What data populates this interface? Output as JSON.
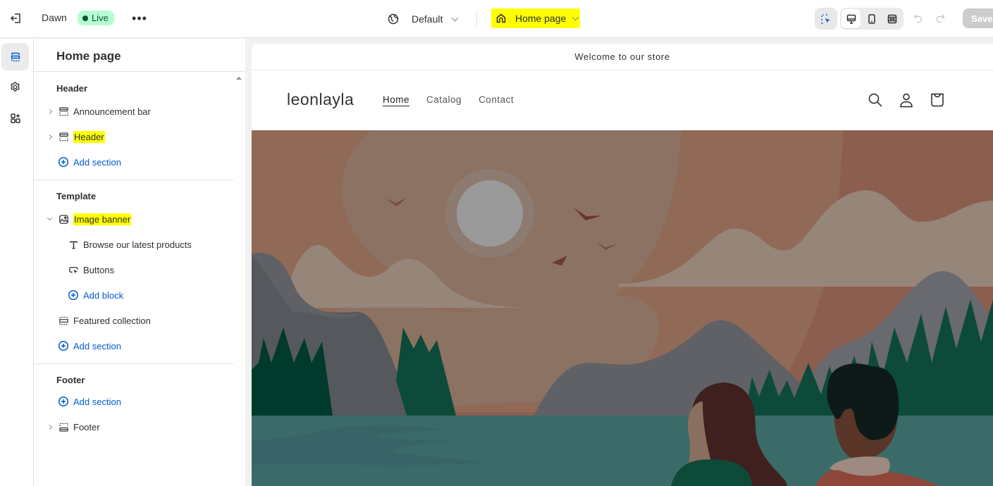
{
  "topbar": {
    "theme_name": "Dawn",
    "status_badge": "Live",
    "more_label": "•••",
    "market_label": "Default",
    "page_selector_label": "Home page",
    "save_label": "Save"
  },
  "rail": {
    "items": [
      {
        "name": "sections",
        "active": true
      },
      {
        "name": "theme-settings",
        "active": false
      },
      {
        "name": "apps",
        "active": false
      }
    ]
  },
  "panel": {
    "title": "Home page",
    "groups": {
      "header": {
        "title": "Header",
        "items": [
          "Announcement bar",
          "Header"
        ],
        "add_label": "Add section"
      },
      "template": {
        "title": "Template",
        "section": "Image banner",
        "blocks": [
          "Browse our latest products",
          "Buttons"
        ],
        "add_block_label": "Add block",
        "other_section": "Featured collection",
        "add_label": "Add section"
      },
      "footer": {
        "title": "Footer",
        "add_label": "Add section",
        "items": [
          "Footer"
        ]
      }
    }
  },
  "preview": {
    "announcement": "Welcome to our store",
    "store_name": "leonlayla",
    "nav": [
      "Home",
      "Catalog",
      "Contact"
    ],
    "colors": {
      "sky_light": "#8b7262",
      "sky_mid": "#906a57",
      "sky_dark": "#8c5e4f",
      "cloud": "#968579",
      "moon": "#9a9a9a",
      "mountain": "#5f6166",
      "trees": "#0e4a3a",
      "lake": "#3b6b69"
    }
  },
  "highlight_color": "#ffff00",
  "accent_color": "#005bd3"
}
